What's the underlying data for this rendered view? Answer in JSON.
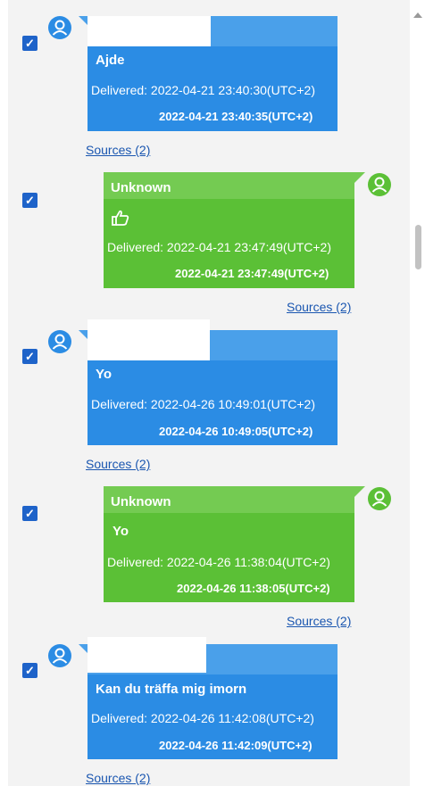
{
  "colors": {
    "outgoing_bubble": "#2b8ce4",
    "incoming_bubble": "#5bc036",
    "checkbox": "#1e63c9",
    "link": "#1a56b0"
  },
  "messages": [
    {
      "direction": "outgoing",
      "checked": true,
      "sender": "",
      "body": "Ajde",
      "delivered": "Delivered: 2022-04-21 23:40:30(UTC+2)",
      "read_time": "2022-04-21 23:40:35(UTC+2)",
      "sources": "Sources (2)"
    },
    {
      "direction": "incoming",
      "checked": true,
      "sender": "Unknown",
      "body_icon": "thumbs-up-icon",
      "delivered": "Delivered: 2022-04-21 23:47:49(UTC+2)",
      "read_time": "2022-04-21 23:47:49(UTC+2)",
      "sources": "Sources (2)"
    },
    {
      "direction": "outgoing",
      "checked": true,
      "sender": "",
      "body": "Yo",
      "delivered": "Delivered: 2022-04-26 10:49:01(UTC+2)",
      "read_time": "2022-04-26 10:49:05(UTC+2)",
      "sources": "Sources (2)"
    },
    {
      "direction": "incoming",
      "checked": true,
      "sender": "Unknown",
      "body": "Yo",
      "delivered": "Delivered: 2022-04-26 11:38:04(UTC+2)",
      "read_time": "2022-04-26 11:38:05(UTC+2)",
      "sources": "Sources (2)"
    },
    {
      "direction": "outgoing",
      "checked": true,
      "sender": "",
      "body": "Kan du träffa mig imorn",
      "delivered": "Delivered: 2022-04-26 11:42:08(UTC+2)",
      "read_time": "2022-04-26 11:42:09(UTC+2)",
      "sources": "Sources (2)"
    }
  ]
}
